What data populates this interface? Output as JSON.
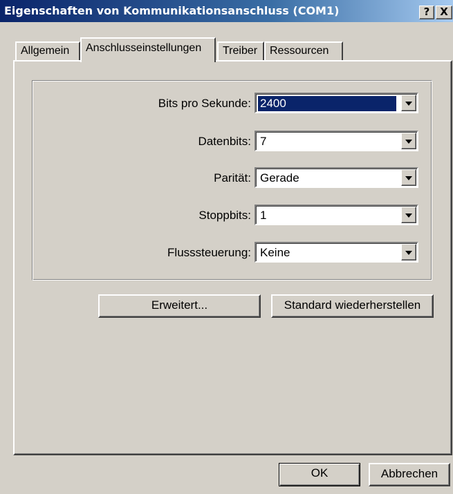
{
  "window": {
    "title": "Eigenschaften von Kommunikationsanschluss (COM1)",
    "help_label": "?",
    "close_label": "X"
  },
  "tabs": [
    {
      "label": "Allgemein",
      "active": false
    },
    {
      "label": "Anschlusseinstellungen",
      "active": true
    },
    {
      "label": "Treiber",
      "active": false
    },
    {
      "label": "Ressourcen",
      "active": false
    }
  ],
  "settings": {
    "bits_per_second": {
      "label": "Bits pro Sekunde:",
      "value": "2400"
    },
    "data_bits": {
      "label": "Datenbits:",
      "value": "7"
    },
    "parity": {
      "label": "Parität:",
      "value": "Gerade"
    },
    "stop_bits": {
      "label": "Stoppbits:",
      "value": "1"
    },
    "flow_control": {
      "label": "Flusssteuerung:",
      "value": "Keine"
    }
  },
  "buttons": {
    "advanced": "Erweitert...",
    "restore_defaults": "Standard wiederherstellen",
    "ok": "OK",
    "cancel": "Abbrechen"
  },
  "colors": {
    "face": "#d4d0c8",
    "title_start": "#0a246a",
    "title_end": "#a6caf0",
    "selection": "#0a246a"
  }
}
